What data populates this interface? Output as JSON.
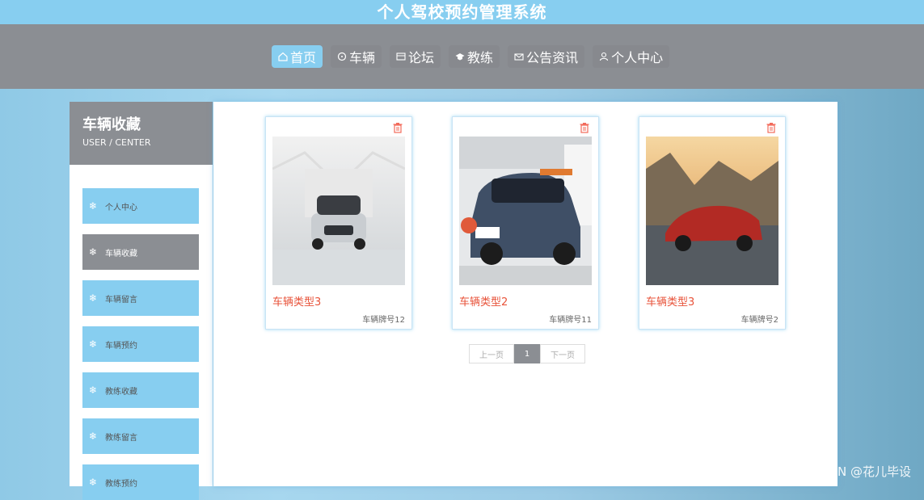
{
  "header": {
    "title": "个人驾校预约管理系统"
  },
  "nav": [
    {
      "label": "首页",
      "icon": "home-icon",
      "active": true
    },
    {
      "label": "车辆",
      "icon": "steering-wheel-icon"
    },
    {
      "label": "论坛",
      "icon": "forum-icon"
    },
    {
      "label": "教练",
      "icon": "graduation-cap-icon"
    },
    {
      "label": "公告资讯",
      "icon": "mail-icon"
    },
    {
      "label": "个人中心",
      "icon": "user-icon"
    }
  ],
  "sidebar": {
    "title": "车辆收藏",
    "subtitle": "USER / CENTER",
    "items": [
      {
        "label": "个人中心",
        "icon": "snowflake-icon"
      },
      {
        "label": "车辆收藏",
        "icon": "snowflake-icon",
        "active": true
      },
      {
        "label": "车辆留言",
        "icon": "snowflake-icon"
      },
      {
        "label": "车辆预约",
        "icon": "snowflake-icon"
      },
      {
        "label": "教练收藏",
        "icon": "snowflake-icon"
      },
      {
        "label": "教练留言",
        "icon": "snowflake-icon"
      },
      {
        "label": "教练预约",
        "icon": "snowflake-icon"
      }
    ]
  },
  "cards": [
    {
      "name": "车辆类型3",
      "plate": "车辆牌号12",
      "image": "silver convertible in white studio"
    },
    {
      "name": "车辆类型2",
      "plate": "车辆牌号11",
      "image": "blue compact car in showroom"
    },
    {
      "name": "车辆类型3",
      "plate": "车辆牌号2",
      "image": "red sports car on coastal road at sunset"
    }
  ],
  "pager": {
    "prev": "上一页",
    "page": "1",
    "next": "下一页"
  },
  "watermark": "CSDN @花儿毕设",
  "colors": {
    "accent": "#87cef0",
    "gray": "#8b8e93",
    "title_red": "#e8533a"
  }
}
